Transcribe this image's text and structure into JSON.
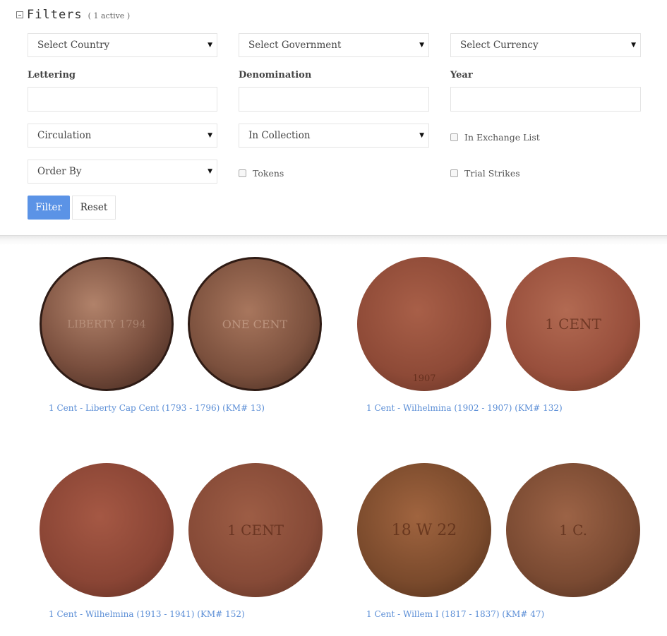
{
  "filters": {
    "title": "Filters",
    "active": "( 1 active )",
    "country": "Select Country",
    "government": "Select Government",
    "currency": "Select Currency",
    "lettering_label": "Lettering",
    "denomination_label": "Denomination",
    "year_label": "Year",
    "lettering_value": "",
    "denomination_value": "",
    "year_value": "",
    "circulation": "Circulation",
    "in_collection": "In Collection",
    "exchange_list": "In Exchange List",
    "order_by": "Order By",
    "tokens": "Tokens",
    "trial_strikes": "Trial Strikes",
    "filter_button": "Filter",
    "reset_button": "Reset",
    "arrow": "▼"
  },
  "coins": [
    {
      "title": "1 Cent - Liberty Cap Cent (1793 - 1796) (KM# 13)",
      "obverse": "LIBERTY 1794",
      "reverse": "ONE CENT"
    },
    {
      "title": "1 Cent - Wilhelmina (1902 - 1907) (KM# 132)",
      "obverse": "1907",
      "reverse": "1 CENT"
    },
    {
      "title": "1 Cent - Wilhelmina (1913 - 1941) (KM# 152)",
      "obverse": "",
      "reverse": "1 CENT"
    },
    {
      "title": "1 Cent - Willem I (1817 - 1837) (KM# 47)",
      "obverse": "18 W 22",
      "reverse": "1 C."
    }
  ],
  "colors": {
    "accent": "#5b93e6",
    "link": "#5b8ed6"
  }
}
